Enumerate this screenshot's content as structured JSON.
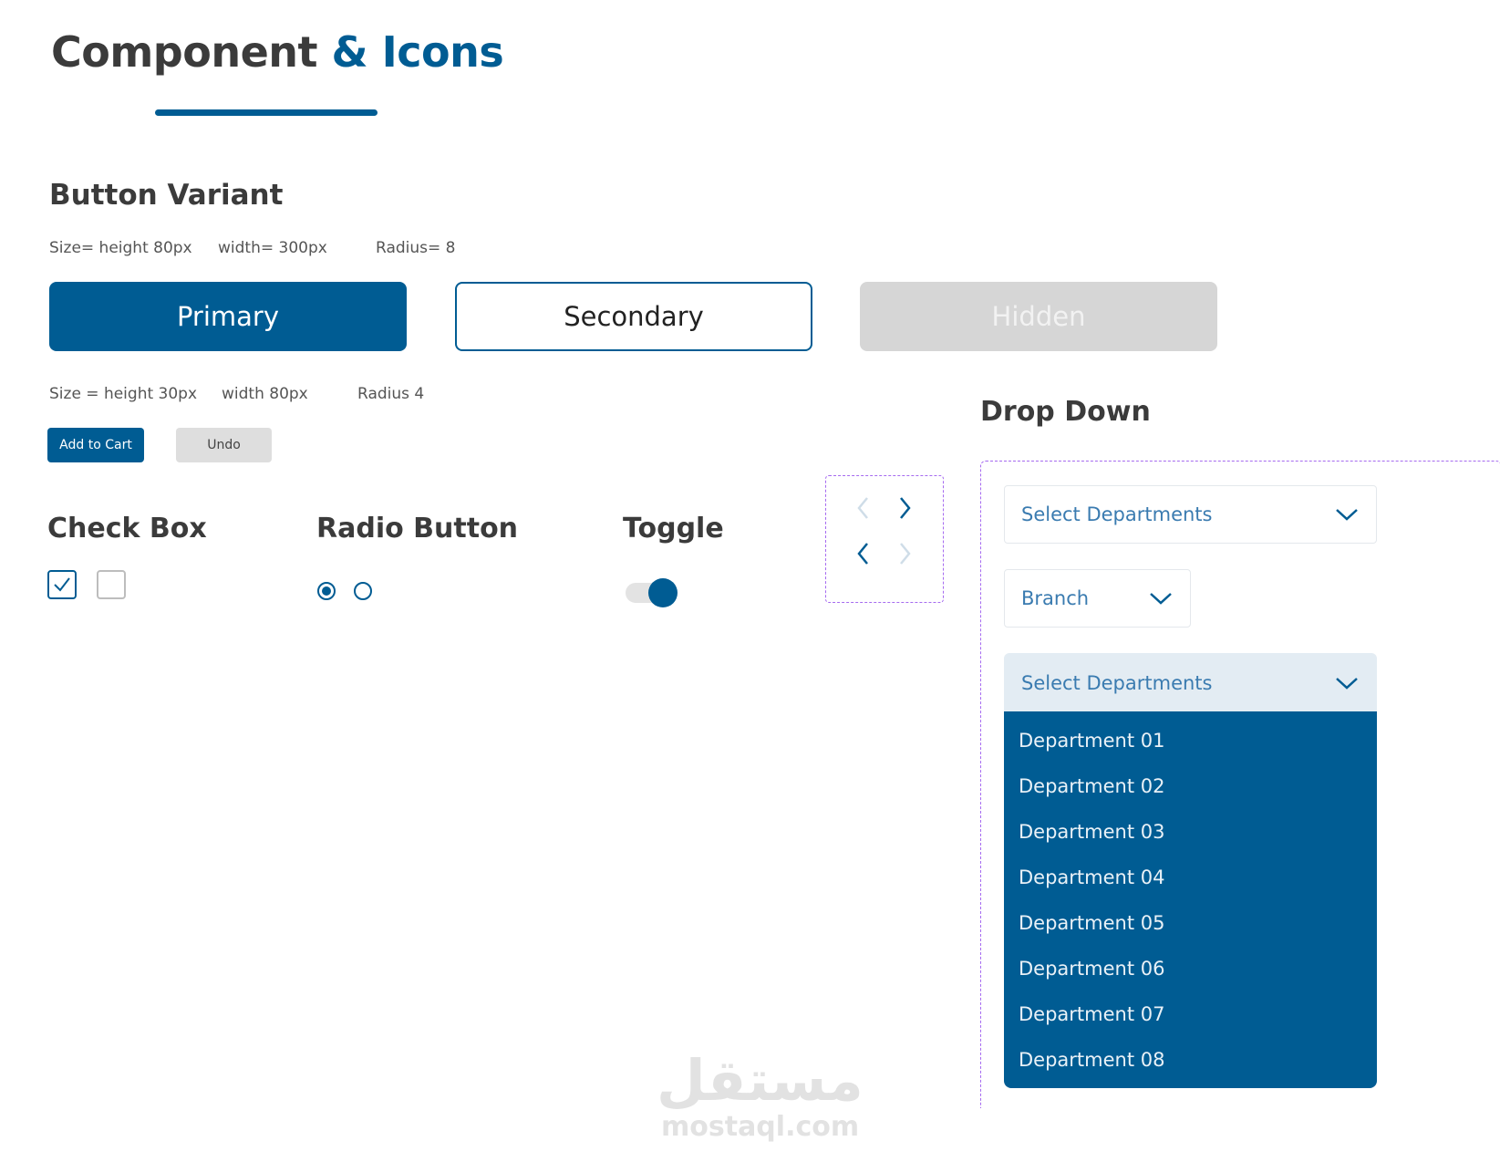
{
  "title": {
    "part1": "Component",
    "part2": "& Icons"
  },
  "button_variant": {
    "heading": "Button Variant",
    "large_specs": {
      "size": "Size= height 80px",
      "width": "width= 300px",
      "radius": "Radius= 8"
    },
    "buttons": {
      "primary": "Primary",
      "secondary": "Secondary",
      "hidden": "Hidden"
    },
    "small_specs": {
      "size": "Size = height 30px",
      "width": "width 80px",
      "radius": "Radius 4"
    },
    "small_buttons": {
      "add_to_cart": "Add to Cart",
      "undo": "Undo"
    }
  },
  "checkbox": {
    "heading": "Check Box",
    "items": [
      {
        "checked": true
      },
      {
        "checked": false
      }
    ]
  },
  "radio": {
    "heading": "Radio Button",
    "items": [
      {
        "selected": true
      },
      {
        "selected": false
      }
    ]
  },
  "toggle": {
    "heading": "Toggle",
    "on": true
  },
  "arrows": {
    "icons": [
      "chevron-left-icon",
      "chevron-right-icon"
    ]
  },
  "dropdown": {
    "heading": "Drop Down",
    "field1": "Select Departments",
    "field2": "Branch",
    "field3": "Select Departments",
    "options": [
      "Department 01",
      "Department 02",
      "Department 03",
      "Department 04",
      "Department 05",
      "Department 06",
      "Department 07",
      "Department 08"
    ]
  },
  "watermark": {
    "arabic": "مستقل",
    "latin": "mostaql.com"
  },
  "colors": {
    "primary": "#005c93",
    "hidden": "#d6d6d6",
    "dashed_frame": "#a66bf0",
    "dropdown_open_header": "#e3ecf3"
  }
}
